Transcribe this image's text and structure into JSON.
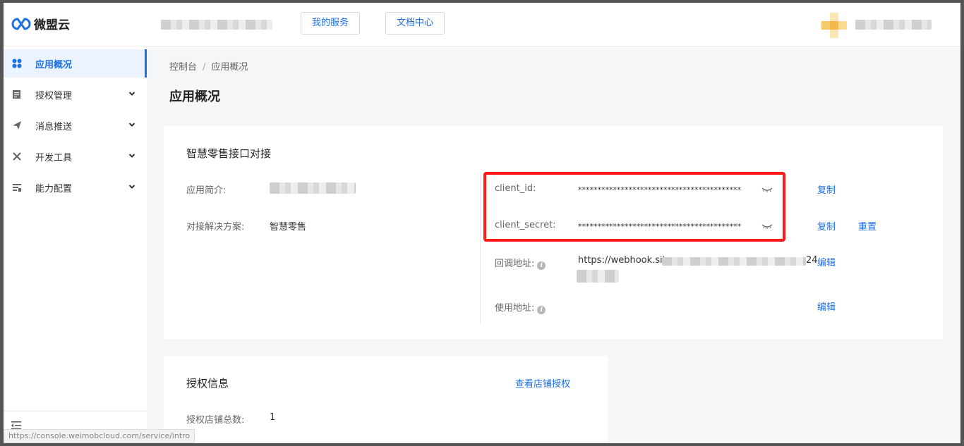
{
  "header": {
    "brand": "微盟云",
    "nav": [
      "我的服务",
      "文档中心"
    ]
  },
  "sidebar": {
    "items": [
      {
        "label": "应用概况",
        "icon": "apps-icon",
        "active": true
      },
      {
        "label": "授权管理",
        "icon": "document-icon",
        "expandable": true
      },
      {
        "label": "消息推送",
        "icon": "send-icon",
        "expandable": true
      },
      {
        "label": "开发工具",
        "icon": "tools-icon",
        "expandable": true
      },
      {
        "label": "能力配置",
        "icon": "settings-list-icon",
        "expandable": true
      }
    ],
    "status_url": "https://console.weimobcloud.com/service/intro"
  },
  "breadcrumb": [
    "控制台",
    "应用概况"
  ],
  "page_title": "应用概况",
  "app_card": {
    "title": "智慧零售接口对接",
    "intro_label": "应用简介:",
    "solution_label": "对接解决方案:",
    "solution_value": "智慧零售",
    "client_id_label": "client_id:",
    "client_id_value": "******************************************",
    "client_secret_label": "client_secret:",
    "client_secret_value": "******************************************",
    "callback_label": "回调地址:",
    "callback_value_prefix": "https://webhook.sit",
    "callback_value_suffix": "24",
    "usage_label": "使用地址:",
    "copy_label": "复制",
    "reset_label": "重置",
    "edit_label": "编辑"
  },
  "auth_card": {
    "title": "授权信息",
    "view_link": "查看店铺授权",
    "store_total_label": "授权店铺总数:",
    "store_total_value": "1"
  },
  "colors": {
    "accent": "#1f6fe5",
    "highlight": "#ff1a1a"
  }
}
